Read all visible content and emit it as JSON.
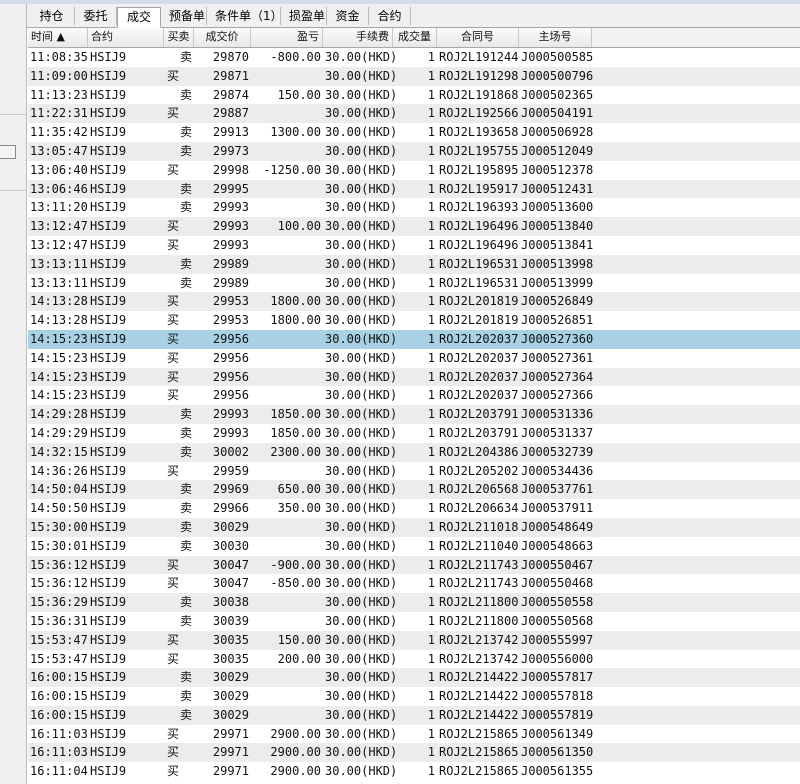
{
  "tabs": [
    "持仓",
    "委托",
    "成交",
    "预备单",
    "条件单（1）",
    "损盈单",
    "资金",
    "合约"
  ],
  "active_tab": 2,
  "columns": [
    "时间 ▲",
    "合约",
    "买卖",
    "成交价",
    "盈亏",
    "手续费",
    "成交量",
    "合同号",
    "主场号"
  ],
  "colors": {
    "buy": "#d40000",
    "sell": "#009a00",
    "selected_row": "#a9d1e6"
  },
  "rows": [
    {
      "time": "11:08:35",
      "symbol": "HSIJ9",
      "side": "卖",
      "price": "29870",
      "pl": "-800.00",
      "fee": "30.00(HKD)",
      "qty": "1",
      "contract": "ROJ2L191244",
      "market": "J000500585"
    },
    {
      "time": "11:09:00",
      "symbol": "HSIJ9",
      "side": "买",
      "price": "29871",
      "pl": "",
      "fee": "30.00(HKD)",
      "qty": "1",
      "contract": "ROJ2L191298",
      "market": "J000500796"
    },
    {
      "time": "11:13:23",
      "symbol": "HSIJ9",
      "side": "卖",
      "price": "29874",
      "pl": "150.00",
      "fee": "30.00(HKD)",
      "qty": "1",
      "contract": "ROJ2L191868",
      "market": "J000502365"
    },
    {
      "time": "11:22:31",
      "symbol": "HSIJ9",
      "side": "买",
      "price": "29887",
      "pl": "",
      "fee": "30.00(HKD)",
      "qty": "1",
      "contract": "ROJ2L192566",
      "market": "J000504191"
    },
    {
      "time": "11:35:42",
      "symbol": "HSIJ9",
      "side": "卖",
      "price": "29913",
      "pl": "1300.00",
      "fee": "30.00(HKD)",
      "qty": "1",
      "contract": "ROJ2L193658",
      "market": "J000506928"
    },
    {
      "time": "13:05:47",
      "symbol": "HSIJ9",
      "side": "卖",
      "price": "29973",
      "pl": "",
      "fee": "30.00(HKD)",
      "qty": "1",
      "contract": "ROJ2L195755",
      "market": "J000512049"
    },
    {
      "time": "13:06:40",
      "symbol": "HSIJ9",
      "side": "买",
      "price": "29998",
      "pl": "-1250.00",
      "fee": "30.00(HKD)",
      "qty": "1",
      "contract": "ROJ2L195895",
      "market": "J000512378"
    },
    {
      "time": "13:06:46",
      "symbol": "HSIJ9",
      "side": "卖",
      "price": "29995",
      "pl": "",
      "fee": "30.00(HKD)",
      "qty": "1",
      "contract": "ROJ2L195917",
      "market": "J000512431"
    },
    {
      "time": "13:11:20",
      "symbol": "HSIJ9",
      "side": "卖",
      "price": "29993",
      "pl": "",
      "fee": "30.00(HKD)",
      "qty": "1",
      "contract": "ROJ2L196393",
      "market": "J000513600"
    },
    {
      "time": "13:12:47",
      "symbol": "HSIJ9",
      "side": "买",
      "price": "29993",
      "pl": "100.00",
      "fee": "30.00(HKD)",
      "qty": "1",
      "contract": "ROJ2L196496",
      "market": "J000513840"
    },
    {
      "time": "13:12:47",
      "symbol": "HSIJ9",
      "side": "买",
      "price": "29993",
      "pl": "",
      "fee": "30.00(HKD)",
      "qty": "1",
      "contract": "ROJ2L196496",
      "market": "J000513841"
    },
    {
      "time": "13:13:11",
      "symbol": "HSIJ9",
      "side": "卖",
      "price": "29989",
      "pl": "",
      "fee": "30.00(HKD)",
      "qty": "1",
      "contract": "ROJ2L196531",
      "market": "J000513998"
    },
    {
      "time": "13:13:11",
      "symbol": "HSIJ9",
      "side": "卖",
      "price": "29989",
      "pl": "",
      "fee": "30.00(HKD)",
      "qty": "1",
      "contract": "ROJ2L196531",
      "market": "J000513999"
    },
    {
      "time": "14:13:28",
      "symbol": "HSIJ9",
      "side": "买",
      "price": "29953",
      "pl": "1800.00",
      "fee": "30.00(HKD)",
      "qty": "1",
      "contract": "ROJ2L201819",
      "market": "J000526849"
    },
    {
      "time": "14:13:28",
      "symbol": "HSIJ9",
      "side": "买",
      "price": "29953",
      "pl": "1800.00",
      "fee": "30.00(HKD)",
      "qty": "1",
      "contract": "ROJ2L201819",
      "market": "J000526851"
    },
    {
      "time": "14:15:23",
      "symbol": "HSIJ9",
      "side": "买",
      "price": "29956",
      "pl": "",
      "fee": "30.00(HKD)",
      "qty": "1",
      "contract": "ROJ2L202037",
      "market": "J000527360",
      "selected": true
    },
    {
      "time": "14:15:23",
      "symbol": "HSIJ9",
      "side": "买",
      "price": "29956",
      "pl": "",
      "fee": "30.00(HKD)",
      "qty": "1",
      "contract": "ROJ2L202037",
      "market": "J000527361"
    },
    {
      "time": "14:15:23",
      "symbol": "HSIJ9",
      "side": "买",
      "price": "29956",
      "pl": "",
      "fee": "30.00(HKD)",
      "qty": "1",
      "contract": "ROJ2L202037",
      "market": "J000527364"
    },
    {
      "time": "14:15:23",
      "symbol": "HSIJ9",
      "side": "买",
      "price": "29956",
      "pl": "",
      "fee": "30.00(HKD)",
      "qty": "1",
      "contract": "ROJ2L202037",
      "market": "J000527366"
    },
    {
      "time": "14:29:28",
      "symbol": "HSIJ9",
      "side": "卖",
      "price": "29993",
      "pl": "1850.00",
      "fee": "30.00(HKD)",
      "qty": "1",
      "contract": "ROJ2L203791",
      "market": "J000531336"
    },
    {
      "time": "14:29:29",
      "symbol": "HSIJ9",
      "side": "卖",
      "price": "29993",
      "pl": "1850.00",
      "fee": "30.00(HKD)",
      "qty": "1",
      "contract": "ROJ2L203791",
      "market": "J000531337"
    },
    {
      "time": "14:32:15",
      "symbol": "HSIJ9",
      "side": "卖",
      "price": "30002",
      "pl": "2300.00",
      "fee": "30.00(HKD)",
      "qty": "1",
      "contract": "ROJ2L204386",
      "market": "J000532739"
    },
    {
      "time": "14:36:26",
      "symbol": "HSIJ9",
      "side": "买",
      "price": "29959",
      "pl": "",
      "fee": "30.00(HKD)",
      "qty": "1",
      "contract": "ROJ2L205202",
      "market": "J000534436"
    },
    {
      "time": "14:50:04",
      "symbol": "HSIJ9",
      "side": "卖",
      "price": "29969",
      "pl": "650.00",
      "fee": "30.00(HKD)",
      "qty": "1",
      "contract": "ROJ2L206568",
      "market": "J000537761"
    },
    {
      "time": "14:50:50",
      "symbol": "HSIJ9",
      "side": "卖",
      "price": "29966",
      "pl": "350.00",
      "fee": "30.00(HKD)",
      "qty": "1",
      "contract": "ROJ2L206634",
      "market": "J000537911"
    },
    {
      "time": "15:30:00",
      "symbol": "HSIJ9",
      "side": "卖",
      "price": "30029",
      "pl": "",
      "fee": "30.00(HKD)",
      "qty": "1",
      "contract": "ROJ2L211018",
      "market": "J000548649"
    },
    {
      "time": "15:30:01",
      "symbol": "HSIJ9",
      "side": "卖",
      "price": "30030",
      "pl": "",
      "fee": "30.00(HKD)",
      "qty": "1",
      "contract": "ROJ2L211040",
      "market": "J000548663"
    },
    {
      "time": "15:36:12",
      "symbol": "HSIJ9",
      "side": "买",
      "price": "30047",
      "pl": "-900.00",
      "fee": "30.00(HKD)",
      "qty": "1",
      "contract": "ROJ2L211743",
      "market": "J000550467"
    },
    {
      "time": "15:36:12",
      "symbol": "HSIJ9",
      "side": "买",
      "price": "30047",
      "pl": "-850.00",
      "fee": "30.00(HKD)",
      "qty": "1",
      "contract": "ROJ2L211743",
      "market": "J000550468"
    },
    {
      "time": "15:36:29",
      "symbol": "HSIJ9",
      "side": "卖",
      "price": "30038",
      "pl": "",
      "fee": "30.00(HKD)",
      "qty": "1",
      "contract": "ROJ2L211800",
      "market": "J000550558"
    },
    {
      "time": "15:36:31",
      "symbol": "HSIJ9",
      "side": "卖",
      "price": "30039",
      "pl": "",
      "fee": "30.00(HKD)",
      "qty": "1",
      "contract": "ROJ2L211800",
      "market": "J000550568"
    },
    {
      "time": "15:53:47",
      "symbol": "HSIJ9",
      "side": "买",
      "price": "30035",
      "pl": "150.00",
      "fee": "30.00(HKD)",
      "qty": "1",
      "contract": "ROJ2L213742",
      "market": "J000555997"
    },
    {
      "time": "15:53:47",
      "symbol": "HSIJ9",
      "side": "买",
      "price": "30035",
      "pl": "200.00",
      "fee": "30.00(HKD)",
      "qty": "1",
      "contract": "ROJ2L213742",
      "market": "J000556000"
    },
    {
      "time": "16:00:15",
      "symbol": "HSIJ9",
      "side": "卖",
      "price": "30029",
      "pl": "",
      "fee": "30.00(HKD)",
      "qty": "1",
      "contract": "ROJ2L214422",
      "market": "J000557817"
    },
    {
      "time": "16:00:15",
      "symbol": "HSIJ9",
      "side": "卖",
      "price": "30029",
      "pl": "",
      "fee": "30.00(HKD)",
      "qty": "1",
      "contract": "ROJ2L214422",
      "market": "J000557818"
    },
    {
      "time": "16:00:15",
      "symbol": "HSIJ9",
      "side": "卖",
      "price": "30029",
      "pl": "",
      "fee": "30.00(HKD)",
      "qty": "1",
      "contract": "ROJ2L214422",
      "market": "J000557819"
    },
    {
      "time": "16:11:03",
      "symbol": "HSIJ9",
      "side": "买",
      "price": "29971",
      "pl": "2900.00",
      "fee": "30.00(HKD)",
      "qty": "1",
      "contract": "ROJ2L215865",
      "market": "J000561349"
    },
    {
      "time": "16:11:03",
      "symbol": "HSIJ9",
      "side": "买",
      "price": "29971",
      "pl": "2900.00",
      "fee": "30.00(HKD)",
      "qty": "1",
      "contract": "ROJ2L215865",
      "market": "J000561350"
    },
    {
      "time": "16:11:04",
      "symbol": "HSIJ9",
      "side": "买",
      "price": "29971",
      "pl": "2900.00",
      "fee": "30.00(HKD)",
      "qty": "1",
      "contract": "ROJ2L215865",
      "market": "J000561355"
    }
  ]
}
